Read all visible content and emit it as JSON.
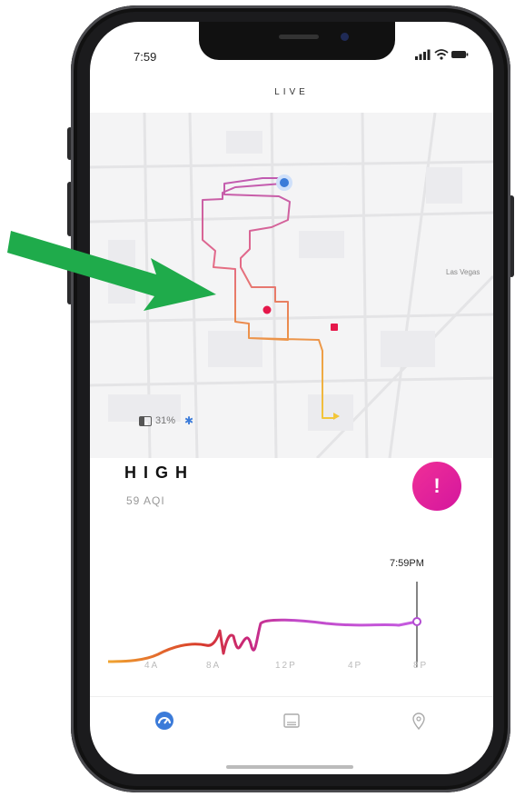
{
  "status_bar": {
    "time": "7:59"
  },
  "header": {
    "title": "LIVE"
  },
  "device": {
    "battery": "31%"
  },
  "air_quality": {
    "level": "HIGH",
    "aqi": "59 AQI",
    "alert_symbol": "!"
  },
  "map": {
    "place_label": "Las Vegas"
  },
  "graph": {
    "current_time": "7:59PM",
    "axis_labels": [
      "4A",
      "8A",
      "12P",
      "4P",
      "8P"
    ]
  },
  "tabs": [
    {
      "icon": "gauge-icon",
      "active": true
    },
    {
      "icon": "list-icon",
      "active": false
    },
    {
      "icon": "location-pin-icon",
      "active": false
    }
  ],
  "colors": {
    "accent": "#3b7bd9",
    "alert": "#e8209a",
    "arrow": "#1fab4b"
  }
}
